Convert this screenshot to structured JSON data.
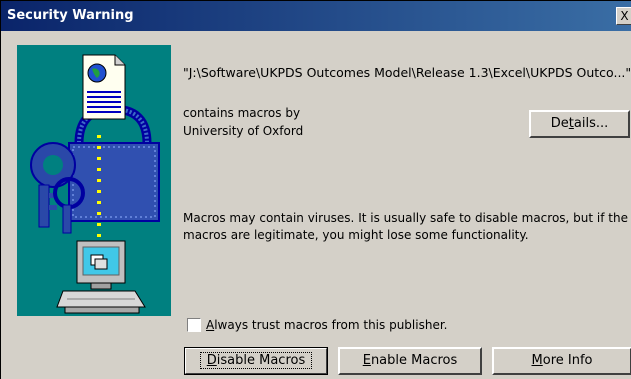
{
  "window": {
    "title": "Security Warning",
    "close_label": "X"
  },
  "message": {
    "file_path": "\"J:\\Software\\UKPDS Outcomes Model\\Release 1.3\\Excel\\UKPDS Outco...\"",
    "contains_line": "contains macros by",
    "publisher": "University of Oxford",
    "warning_line1": "Macros may contain viruses. It is usually safe to disable macros, but if the",
    "warning_line2": "macros are legitimate, you might lose some functionality."
  },
  "buttons": {
    "details": {
      "pre": "De",
      "accel": "t",
      "post": "ails..."
    },
    "disable": {
      "pre": "",
      "accel": "D",
      "post": "isable Macros"
    },
    "enable": {
      "pre": "",
      "accel": "E",
      "post": "nable Macros"
    },
    "more_info": {
      "pre": "",
      "accel": "M",
      "post": "ore Info"
    }
  },
  "checkbox": {
    "accel": "A",
    "label_rest": "lways trust macros from this publisher.",
    "checked": false
  },
  "icons": [
    "document-icon",
    "globe-icon",
    "lock-icon",
    "keys-icon",
    "computer-icon"
  ],
  "colors": {
    "title_start": "#0a246a",
    "title_end": "#3a6ea5",
    "art_bg": "#008080",
    "face": "#d4d0c8"
  }
}
